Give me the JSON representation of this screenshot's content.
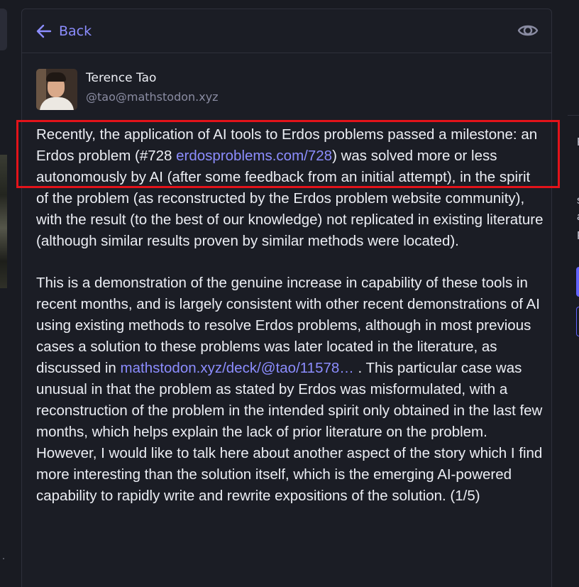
{
  "header": {
    "back_label": "Back",
    "visibility_icon": "eye-icon",
    "back_icon": "arrow-left-icon"
  },
  "author": {
    "display_name": "Terence Tao",
    "handle": "@tao@mathstodon.xyz"
  },
  "post": {
    "p1_before_link": "Recently, the application of AI tools to Erdos problems passed a milestone: an Erdos problem (#728 ",
    "p1_link": "erdosproblems.com/728",
    "p1_after_link": ") was solved more or less autonomously by AI (after some feedback from an initial attempt), in the spirit of the problem (as reconstructed by the Erdos problem website community), with the result (to the best of our knowledge) not replicated in existing literature (although similar results proven by similar methods were located).",
    "p2_before_link": "This is a demonstration of the genuine increase in capability of these tools in recent months, and is largely consistent with other recent demonstrations of AI using existing methods to resolve Erdos problems, although in most previous cases a solution to these problems was later located in the literature, as discussed in ",
    "p2_link": "mathstodon.xyz/deck/@tao/11578…",
    "p2_after_link": " .  This particular case was unusual in that the problem as stated by Erdos was misformulated, with a reconstruction of the problem in the intended spirit only obtained in the last few months, which helps explain the lack of prior literature on the problem.  However, I would like to talk here about another aspect of the story which I find more interesting than the solution itself, which is the emerging AI-powered capability to rapidly write and rewrite expositions of the solution.  (1/5)"
  },
  "right_column": {
    "chars": [
      "F",
      "s",
      "a"
    ]
  },
  "colors": {
    "accent": "#8c8dff",
    "highlight": "#e3131a",
    "background": "#191b22",
    "text": "#eceef4"
  }
}
